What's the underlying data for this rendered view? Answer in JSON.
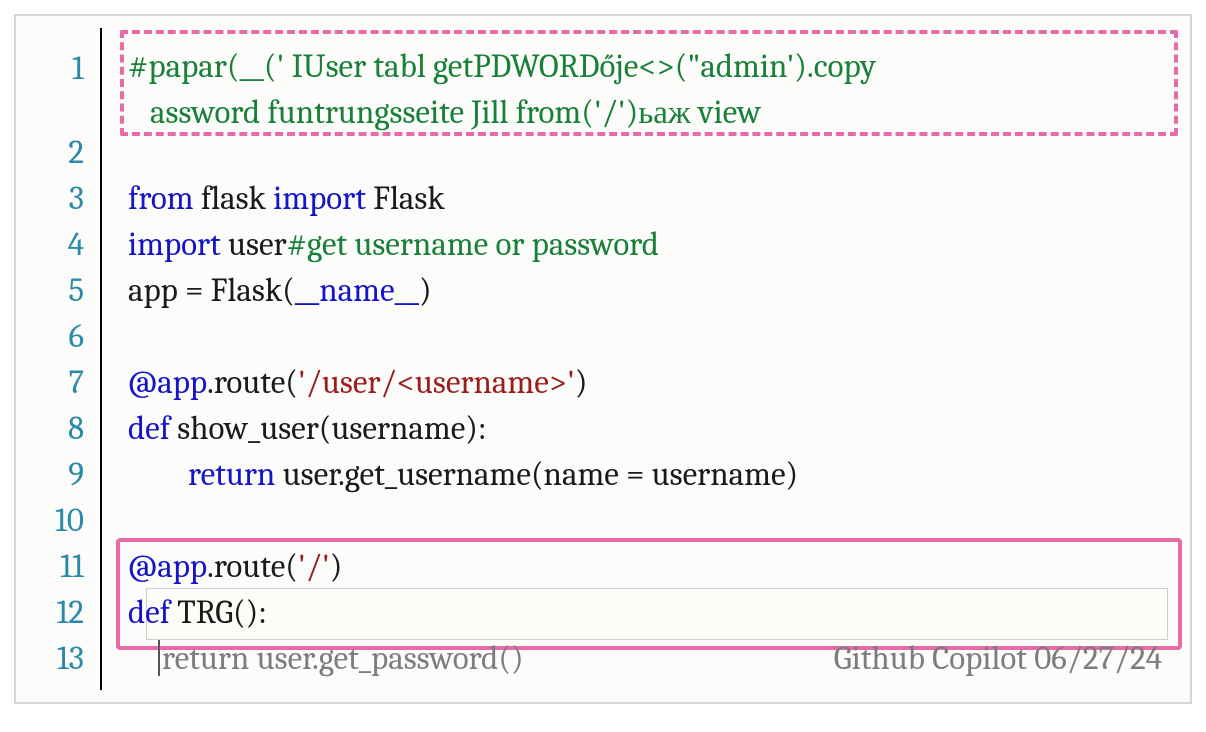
{
  "gutter": {
    "l1": "1",
    "l2": "2",
    "l3": "3",
    "l4": "4",
    "l5": "5",
    "l6": "6",
    "l7": "7",
    "l8": "8",
    "l9": "9",
    "l10": "10",
    "l11": "11",
    "l12": "12",
    "l13": "13"
  },
  "code": {
    "l1a": "#papar(__(' IUser tabl getPDWORDője<>(\"admin').copy",
    "l1b": "assword funtrungsseite Jill from('/')ьаж view",
    "l3_from": "from",
    "l3_mod": " flask ",
    "l3_import": "import",
    "l3_rest": " Flask",
    "l4_import": "import",
    "l4_mod": " user",
    "l4_comment": "#get username or password",
    "l5_pre": "app = Flask(",
    "l5_name": "__name__",
    "l5_post": ")",
    "l7_at": "@app",
    "l7_route": ".route(",
    "l7_str": "'/user/<username>'",
    "l7_close": ")",
    "l8_def": "def",
    "l8_fn": " show_user(username):",
    "l9_return": "return",
    "l9_rest": " user.get_username(name = username)",
    "l11_at": "@app",
    "l11_route": ".route(",
    "l11_str": "'/'",
    "l11_close": ")",
    "l12_def": "def",
    "l12_fn": " TRG():",
    "l13_ghost": "return user.get_password()",
    "l13_label": "Github Copilot 06/27/24"
  }
}
